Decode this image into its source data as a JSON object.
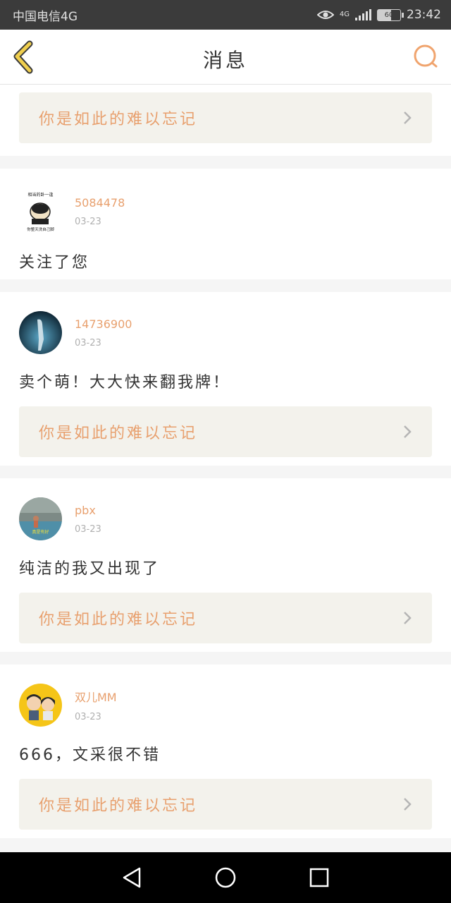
{
  "status_bar": {
    "carrier": "中国电信4G",
    "network": "4G",
    "battery": "60",
    "time": "23:42"
  },
  "header": {
    "title": "消息"
  },
  "accent_color": "#e8a06e",
  "top_quote": {
    "text": "你是如此的难以忘记"
  },
  "messages": [
    {
      "username": "5084478",
      "date": "03-23",
      "text": "关注了您",
      "quote": null,
      "avatar_caption_top": "相当的卧一逢",
      "avatar_caption_bottom": "你整天洗自己脚"
    },
    {
      "username": "14736900",
      "date": "03-23",
      "text": "卖个萌！大大快来翻我牌！",
      "quote": "你是如此的难以忘记"
    },
    {
      "username": "pbx",
      "date": "03-23",
      "text": "纯洁的我又出现了",
      "quote": "你是如此的难以忘记",
      "avatar_caption": "真是有好"
    },
    {
      "username": "双儿MM",
      "date": "03-23",
      "text": "666，文采很不错",
      "quote": "你是如此的难以忘记"
    }
  ],
  "icons": {
    "back": "chevron-left-icon",
    "search": "search-icon",
    "quote_arrow": "chevron-right-icon",
    "nav_back": "triangle-back-icon",
    "nav_home": "circle-home-icon",
    "nav_recent": "square-recent-icon"
  }
}
